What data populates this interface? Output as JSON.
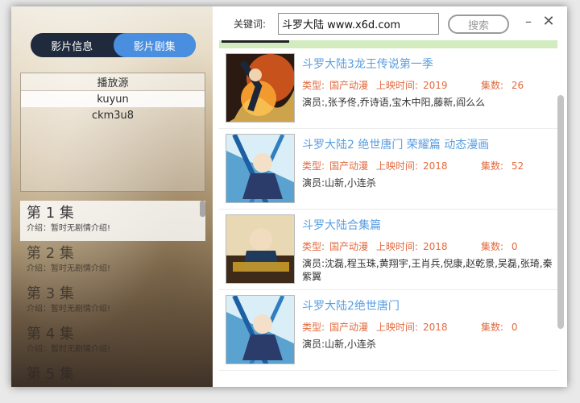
{
  "left": {
    "tabs": [
      {
        "label": "影片信息",
        "active": false
      },
      {
        "label": "影片剧集",
        "active": true
      }
    ],
    "source_header": "播放源",
    "sources": [
      {
        "label": "kuyun",
        "selected": true
      },
      {
        "label": "ckm3u8",
        "selected": false
      }
    ],
    "episodes": [
      {
        "title": "第 1 集",
        "desc": "介绍：暂时无剧情介绍!",
        "selected": true
      },
      {
        "title": "第 2 集",
        "desc": "介绍：暂时无剧情介绍!",
        "selected": false
      },
      {
        "title": "第 3 集",
        "desc": "介绍：暂时无剧情介绍!",
        "selected": false
      },
      {
        "title": "第 4 集",
        "desc": "介绍：暂时无剧情介绍!",
        "selected": false
      },
      {
        "title": "第 5 集",
        "desc": "",
        "selected": false
      }
    ]
  },
  "search": {
    "label": "关键词:",
    "value": "斗罗大陆 www.x6d.com",
    "button": "搜索"
  },
  "window": {
    "minimize": "–",
    "close": "✕"
  },
  "results": [
    {
      "title": "斗罗大陆3龙王传说第一季",
      "type_label": "类型:",
      "type": "国产动漫",
      "year_label": "上映时间:",
      "year": "2019",
      "eps_label": "集数:",
      "eps": "26",
      "cast_label": "演员:",
      "cast": ",张予佟,乔诗语,宝木中阳,藤新,阎么么",
      "thumb_theme": "fire"
    },
    {
      "title": "斗罗大陆2 绝世唐门 荣耀篇 动态漫画",
      "type_label": "类型:",
      "type": "国产动漫",
      "year_label": "上映时间:",
      "year": "2018",
      "eps_label": "集数:",
      "eps": "52",
      "cast_label": "演员:",
      "cast": "山新,小连杀",
      "thumb_theme": "ice"
    },
    {
      "title": "斗罗大陆合集篇",
      "type_label": "类型:",
      "type": "国产动漫",
      "year_label": "上映时间:",
      "year": "2018",
      "eps_label": "集数:",
      "eps": "0",
      "cast_label": "演员:",
      "cast": "沈磊,程玉珠,黄翔宇,王肖兵,倪康,赵乾景,吴磊,张琦,秦紫翼",
      "thumb_theme": "gold"
    },
    {
      "title": "斗罗大陆2绝世唐门",
      "type_label": "类型:",
      "type": "国产动漫",
      "year_label": "上映时间:",
      "year": "2018",
      "eps_label": "集数:",
      "eps": "0",
      "cast_label": "演员:",
      "cast": "山新,小连杀",
      "thumb_theme": "ice"
    }
  ]
}
